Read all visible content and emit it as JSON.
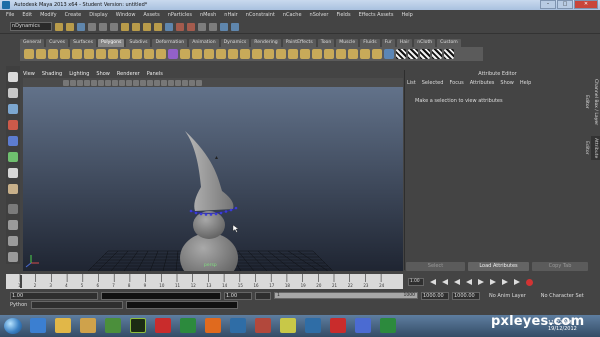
{
  "window": {
    "title": "Autodesk Maya 2013 x64 - Student Version: untitled*"
  },
  "menus": [
    "File",
    "Edit",
    "Modify",
    "Create",
    "Display",
    "Window",
    "Assets",
    "nParticles",
    "nMesh",
    "nHair",
    "nConstraint",
    "nCache",
    "nSolver",
    "Fields",
    "Effects Assets",
    "Help"
  ],
  "status": {
    "mode": "nDynamics"
  },
  "shelf": {
    "tabs": [
      "General",
      "Curves",
      "Surfaces",
      "Polygons",
      "Subdivs",
      "Deformation",
      "Animation",
      "Dynamics",
      "Rendering",
      "PaintEffects",
      "Toon",
      "Muscle",
      "Fluids",
      "Fur",
      "Hair",
      "nCloth",
      "Custom"
    ],
    "active_tab": "Polygons"
  },
  "viewport": {
    "menu": [
      "View",
      "Shading",
      "Lighting",
      "Show",
      "Renderer",
      "Panels"
    ],
    "camera_label": "persp"
  },
  "attribute_editor": {
    "title": "Attribute Editor",
    "menu": [
      "List",
      "Selected",
      "Focus",
      "Attributes",
      "Show",
      "Help"
    ],
    "message": "Make a selection to view attributes",
    "buttons": {
      "select": "Select",
      "load": "Load Attributes",
      "copy": "Copy Tab"
    },
    "side_tabs": {
      "channel_box": "Channel Box / Layer Editor",
      "ae": "Attribute Editor"
    }
  },
  "timeline": {
    "ticks": [
      "1",
      "2",
      "3",
      "4",
      "5",
      "6",
      "7",
      "8",
      "9",
      "10",
      "11",
      "12",
      "13",
      "14",
      "15",
      "16",
      "17",
      "18",
      "19",
      "20",
      "21",
      "22",
      "23",
      "24"
    ],
    "current": "1.00"
  },
  "range": {
    "start": "1.00",
    "end_inner": "1.00",
    "slider_start": "1",
    "slider_end": "1000",
    "end": "1000.00",
    "max": "1000.00",
    "anim_layer": "No Anim Layer",
    "char_set": "No Character Set"
  },
  "command": {
    "label": "Python"
  },
  "taskbar": {
    "time": "11:22 AM",
    "date": "19/12/2012"
  },
  "watermark": {
    "text": "pxleyes.com"
  },
  "colors": {
    "viewport_top": "#5e6c84",
    "viewport_bottom": "#1e2430",
    "shelf_active": "#8a8a8a"
  }
}
